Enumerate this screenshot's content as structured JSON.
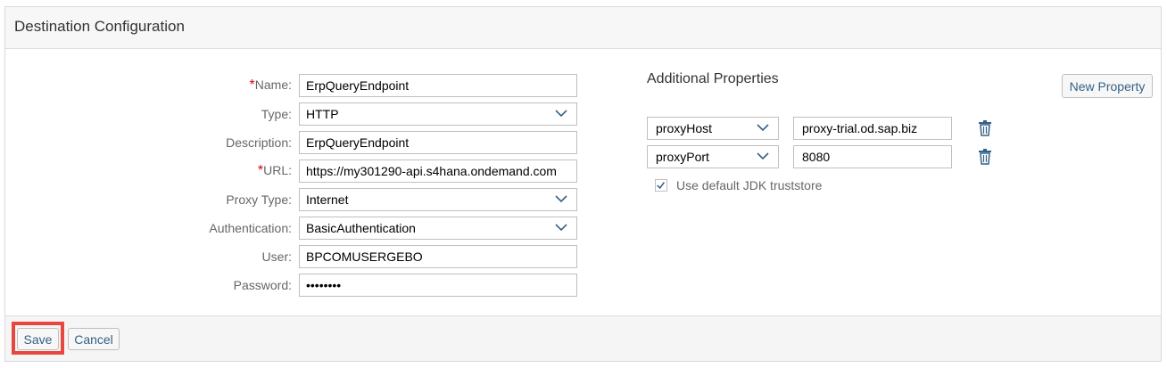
{
  "panel": {
    "title": "Destination Configuration"
  },
  "form": {
    "name": {
      "label": "Name:",
      "required": true,
      "value": "ErpQueryEndpoint"
    },
    "type": {
      "label": "Type:",
      "value": "HTTP"
    },
    "description": {
      "label": "Description:",
      "value": "ErpQueryEndpoint"
    },
    "url": {
      "label": "URL:",
      "required": true,
      "value": "https://my301290-api.s4hana.ondemand.com"
    },
    "proxy_type": {
      "label": "Proxy Type:",
      "value": "Internet"
    },
    "authentication": {
      "label": "Authentication:",
      "value": "BasicAuthentication"
    },
    "user": {
      "label": "User:",
      "value": "BPCOMUSERGEBO"
    },
    "password": {
      "label": "Password:",
      "value": "••••••••"
    },
    "required_marker": "*"
  },
  "additional": {
    "title": "Additional Properties",
    "new_property_label": "New Property",
    "properties": [
      {
        "key": "proxyHost",
        "value": "proxy-trial.od.sap.biz"
      },
      {
        "key": "proxyPort",
        "value": "8080"
      }
    ],
    "truststore_label": "Use default JDK truststore",
    "truststore_checked": true
  },
  "footer": {
    "save_label": "Save",
    "cancel_label": "Cancel"
  },
  "colors": {
    "accent": "#346187",
    "required": "#d0021b",
    "highlight": "#e8473f"
  },
  "icons": {
    "select": "chevron-down-icon",
    "delete": "trash-icon",
    "check": "checkmark-icon"
  }
}
